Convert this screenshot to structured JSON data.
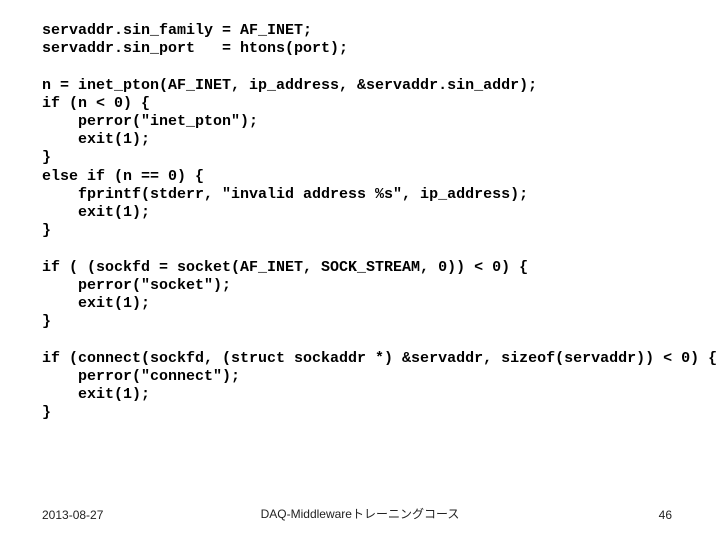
{
  "code": "servaddr.sin_family = AF_INET;\nservaddr.sin_port   = htons(port);\n\nn = inet_pton(AF_INET, ip_address, &servaddr.sin_addr);\nif (n < 0) {\n    perror(\"inet_pton\");\n    exit(1);\n}\nelse if (n == 0) {\n    fprintf(stderr, \"invalid address %s\", ip_address);\n    exit(1);\n}\n\nif ( (sockfd = socket(AF_INET, SOCK_STREAM, 0)) < 0) {\n    perror(\"socket\");\n    exit(1);\n}\n\nif (connect(sockfd, (struct sockaddr *) &servaddr, sizeof(servaddr)) < 0) {\n    perror(\"connect\");\n    exit(1);\n}",
  "footer": {
    "date": "2013-08-27",
    "center": "DAQ-Middlewareトレーニングコース",
    "pageno": "46"
  }
}
